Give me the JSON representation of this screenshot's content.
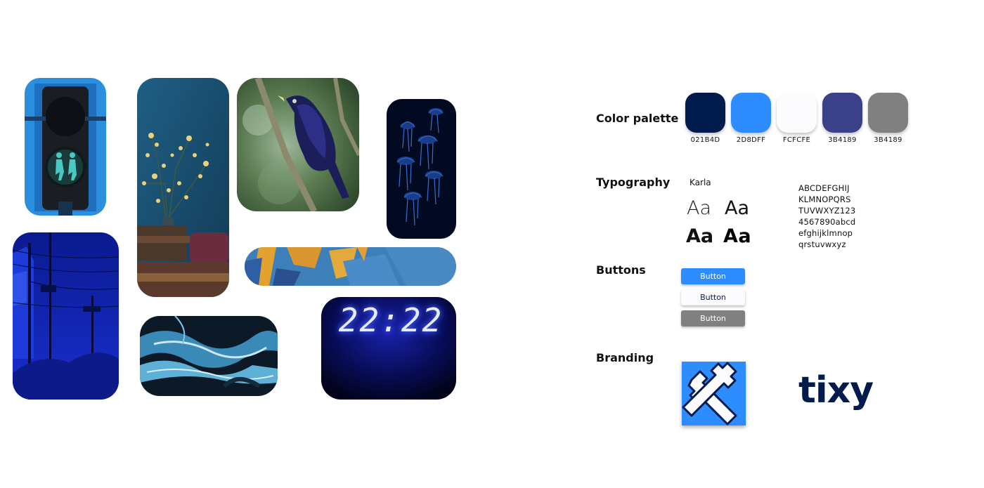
{
  "moodboard": {
    "tiles": [
      {
        "name": "traffic-light-photo",
        "description": ""
      },
      {
        "name": "still-life-photo",
        "description": ""
      },
      {
        "name": "bird-photo",
        "description": ""
      },
      {
        "name": "jellyfish-photo",
        "description": ""
      },
      {
        "name": "night-street-photo",
        "description": ""
      },
      {
        "name": "painting-detail-photo",
        "description": ""
      },
      {
        "name": "marbled-liquid-photo",
        "description": ""
      },
      {
        "name": "digital-clock-photo",
        "clock_text": "22:22"
      }
    ]
  },
  "color_palette": {
    "title": "Color palette",
    "swatches": [
      {
        "hex": "#021B4D",
        "label": "021B4D"
      },
      {
        "hex": "#2D8DFF",
        "label": "2D8DFF"
      },
      {
        "hex": "#FCFCFE",
        "label": "FCFCFE"
      },
      {
        "hex": "#3B4189",
        "label": "3B4189"
      },
      {
        "hex": "#808080",
        "label": "3B4189"
      }
    ]
  },
  "typography": {
    "title": "Typography",
    "font_name": "Karla",
    "samples": [
      "Aa",
      "Aa",
      "Aa",
      "Aa"
    ],
    "alphabet": [
      "ABCDEFGHIJ",
      "KLMNOPQRS",
      "TUVWXYZ123",
      "4567890abcd",
      "efghijklmnop",
      "qrstuvwxyz"
    ]
  },
  "buttons": {
    "title": "Buttons",
    "items": [
      {
        "label": "Button",
        "bg": "#2D8DFF",
        "fg": "#ffffff"
      },
      {
        "label": "Button",
        "bg": "#FCFCFE",
        "fg": "#021B4D"
      },
      {
        "label": "Button",
        "bg": "#808080",
        "fg": "#ffffff"
      }
    ]
  },
  "branding": {
    "title": "Branding",
    "logo_bg": "#2D8DFF",
    "wordmark": "tixy",
    "wordmark_color": "#021B4D"
  }
}
